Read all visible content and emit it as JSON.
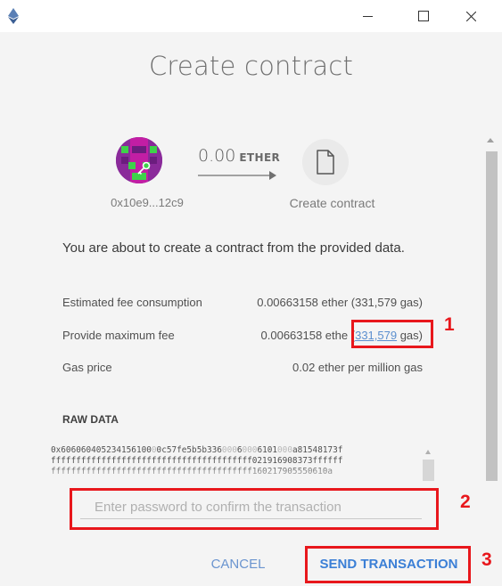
{
  "window": {
    "controls": {
      "minimize": "minimize-icon",
      "maximize": "maximize-icon",
      "close": "close-icon"
    }
  },
  "title": "Create contract",
  "from": {
    "address": "0x10e9...12c9"
  },
  "amount": {
    "value": "0.00",
    "unit": "ETHER"
  },
  "to": {
    "label": "Create contract"
  },
  "info_text": "You are about to create a contract from the provided data.",
  "fees": {
    "estimated_label": "Estimated fee consumption",
    "estimated_value": "0.00663158 ether (331,579 gas)",
    "max_label": "Provide maximum fee",
    "max_value_prefix": "0.00663158 ethe",
    "max_gas_link": "331,579",
    "max_gas_suffix": " gas)",
    "gas_price_label": "Gas price",
    "gas_price_value": "0.02 ether per million gas"
  },
  "raw_data": {
    "label": "RAW DATA",
    "line1": [
      {
        "t": "0x606060405234156100",
        "z": false
      },
      {
        "t": "0",
        "z": true
      },
      {
        "t": "0c57fe5b5b336",
        "z": false
      },
      {
        "t": "000",
        "z": true
      },
      {
        "t": "6",
        "z": false
      },
      {
        "t": "000",
        "z": true
      },
      {
        "t": "6101",
        "z": false
      },
      {
        "t": "000",
        "z": true
      },
      {
        "t": "a81548173f",
        "z": false
      }
    ],
    "line2": "ffffffffffffffffffffffffffffffffffffffff021916908373ffffff",
    "line3": "ffffffffffffffffffffffffffffffffffffffff160217905550610a"
  },
  "password": {
    "placeholder": "Enter password to confirm the transaction",
    "value": ""
  },
  "buttons": {
    "cancel": "CANCEL",
    "send": "SEND TRANSACTION"
  },
  "annotations": {
    "n1": "1",
    "n2": "2",
    "n3": "3",
    "color": "#e8171c"
  },
  "colors": {
    "link": "#5b8fcf",
    "primary_button": "#3b7fd6",
    "avatar": "#8a2a9a"
  }
}
